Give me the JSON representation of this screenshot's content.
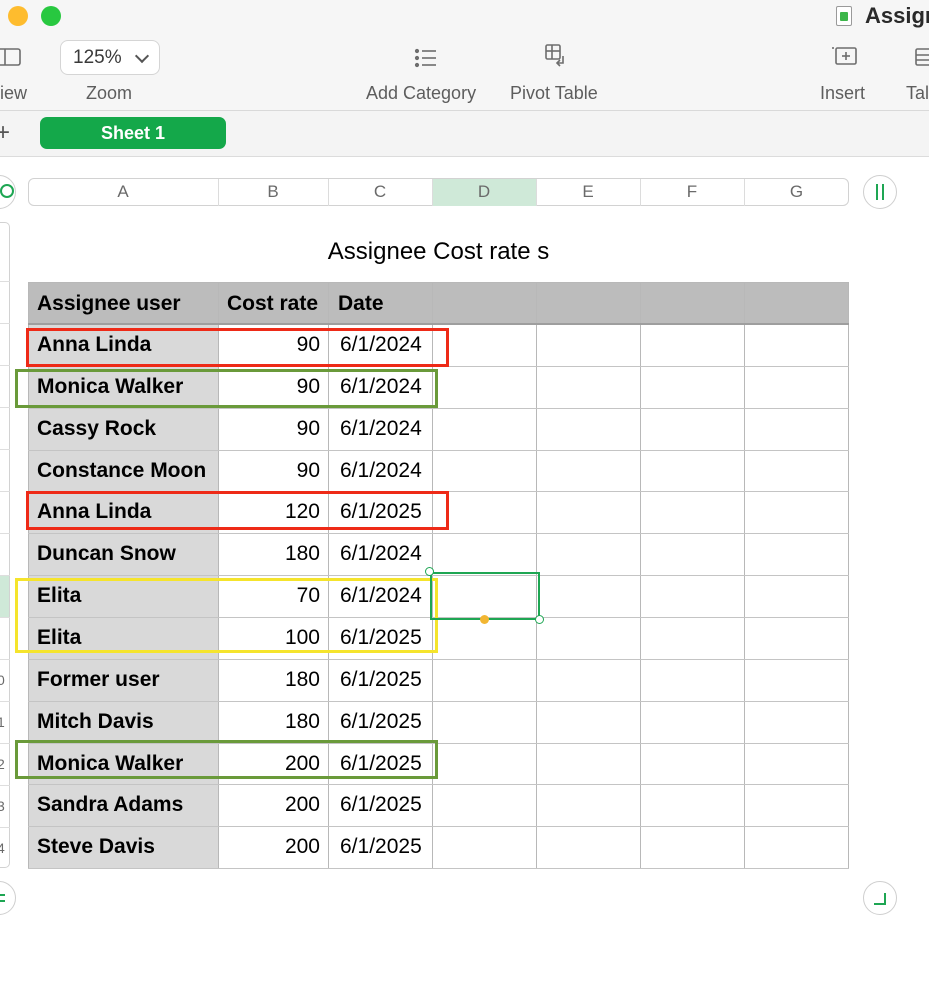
{
  "window": {
    "title": "Assign",
    "traffic_lights": {
      "minimize_color": "#febc2e",
      "zoom_color": "#28c840"
    }
  },
  "toolbar": {
    "view_label": "iew",
    "zoom_label": "Zoom",
    "zoom_value": "125%",
    "add_category_label": "Add Category",
    "pivot_table_label": "Pivot Table",
    "insert_label": "Insert",
    "table_label": "Tal"
  },
  "sheets": {
    "add_label": "+",
    "active_tab": "Sheet 1",
    "accent_color": "#14a84a"
  },
  "columns": [
    "A",
    "B",
    "C",
    "D",
    "E",
    "F",
    "G"
  ],
  "selected_column": "D",
  "row_numbers": [
    "0",
    "1",
    "2",
    "3",
    "4"
  ],
  "table": {
    "title": "Assignee Cost rate s",
    "headers": [
      "Assignee user",
      "Cost rate",
      "Date"
    ],
    "rows": [
      {
        "name": "Anna Linda",
        "rate": "90",
        "date": "6/1/2024"
      },
      {
        "name": "Monica Walker",
        "rate": "90",
        "date": "6/1/2024"
      },
      {
        "name": "Cassy Rock",
        "rate": "90",
        "date": "6/1/2024"
      },
      {
        "name": "Constance Moon",
        "rate": "90",
        "date": "6/1/2024"
      },
      {
        "name": "Anna Linda",
        "rate": "120",
        "date": "6/1/2025"
      },
      {
        "name": "Duncan Snow",
        "rate": "180",
        "date": "6/1/2024"
      },
      {
        "name": "Elita",
        "rate": "70",
        "date": "6/1/2024"
      },
      {
        "name": "Elita",
        "rate": "100",
        "date": "6/1/2025"
      },
      {
        "name": "Former user",
        "rate": "180",
        "date": "6/1/2025"
      },
      {
        "name": "Mitch Davis",
        "rate": "180",
        "date": "6/1/2025"
      },
      {
        "name": "Monica Walker",
        "rate": "200",
        "date": "6/1/2025"
      },
      {
        "name": "Sandra Adams",
        "rate": "200",
        "date": "6/1/2025"
      },
      {
        "name": "Steve Davis",
        "rate": "200",
        "date": "6/1/2025"
      }
    ]
  },
  "annotations": [
    {
      "color": "#ee2a17",
      "rows": [
        1
      ]
    },
    {
      "color": "#6a9a3a",
      "rows": [
        2
      ]
    },
    {
      "color": "#ee2a17",
      "rows": [
        5
      ]
    },
    {
      "color": "#f5e42c",
      "rows": [
        7,
        8
      ]
    },
    {
      "color": "#6a9a3a",
      "rows": [
        11
      ]
    }
  ],
  "colors": {
    "header_fill": "#bcbcbc",
    "first_column_fill": "#d9d9d9",
    "selection": "#1ea653",
    "selected_column_fill": "#cfe9d8"
  }
}
